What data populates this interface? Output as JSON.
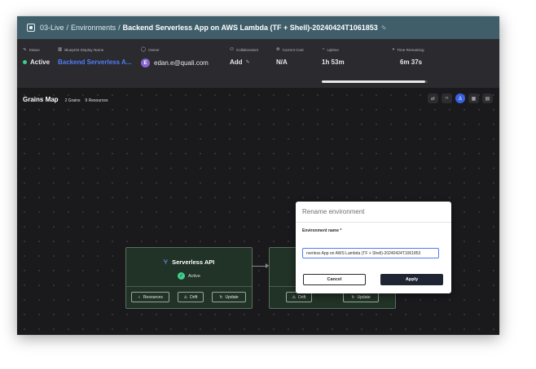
{
  "title_bar": {
    "breadcrumb_root": "03-Live",
    "breadcrumb_section": "Environments",
    "separator": "/",
    "current_environment": "Backend Serverless App on AWS Lambda (TF + Shell)-20240424T1061853"
  },
  "info_bar": {
    "status": {
      "label": "Status",
      "value": "Active",
      "icon": "pulse-icon"
    },
    "blueprint": {
      "label": "Blueprint Display Name",
      "value": "Backend Serverless A...",
      "icon": "map-icon"
    },
    "owner": {
      "label": "Owner",
      "value": "edan.e@quali.com",
      "avatar_letter": "E",
      "icon": "user-icon"
    },
    "collaborators": {
      "label": "Collaborators",
      "value": "Add",
      "icon": "users-icon"
    },
    "current_cost": {
      "label": "Current Cost",
      "value": "N/A",
      "icon": "dollar-icon"
    },
    "uptime": {
      "label": "Uptime",
      "value": "1h 53m",
      "icon": "clock-icon"
    },
    "time_remaining": {
      "label": "Time Remaining",
      "value": "6m 37s",
      "icon": "timer-icon",
      "progress_fraction": 0.98
    }
  },
  "grains_map": {
    "title": "Grains Map",
    "grains_count": "2 Grains",
    "resources_count": "9 Resources",
    "toolbar_icons": [
      "layout-icon",
      "code-icon",
      "account-icon",
      "grid-icon",
      "table-icon"
    ]
  },
  "grains": [
    {
      "title": "Serverless API",
      "status": "Active",
      "buttons": [
        "Resources",
        "Drift",
        "Update"
      ]
    },
    {
      "buttons": [
        "Drift",
        "Update"
      ]
    }
  ],
  "rename_modal": {
    "title": "Rename environment",
    "field_label": "Environment name",
    "required_marker": "*",
    "field_value": "rverless App on AWS Lambda (TF + Shell)-20240424T1061853",
    "cancel_label": "Cancel",
    "apply_label": "Apply"
  },
  "colors": {
    "title_bar": "#3f5e6a",
    "info_bar": "#2b2b2f",
    "map_background": "#1a1a1d",
    "grain_card": "#213226",
    "status_active": "#3ecf8e",
    "link": "#4f7df5",
    "apply_button": "#1f2533"
  }
}
